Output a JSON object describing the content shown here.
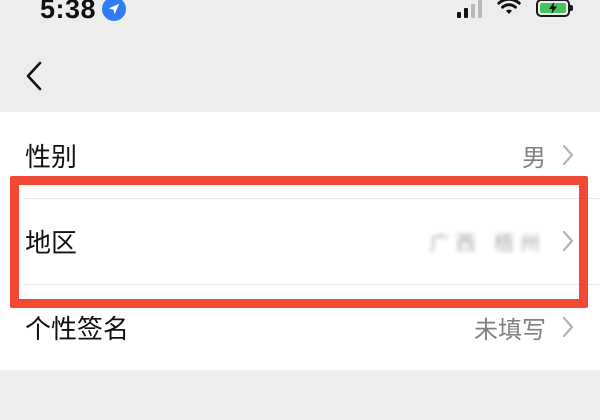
{
  "status_bar": {
    "time": "5:38"
  },
  "settings": {
    "rows": [
      {
        "label": "性别",
        "value": "男"
      },
      {
        "label": "地区",
        "value": "广西 梧州"
      },
      {
        "label": "个性签名",
        "value": "未填写"
      }
    ]
  },
  "colors": {
    "page_bg": "#ededed",
    "highlight": "#f04a35",
    "location_badge": "#2f7cf6",
    "battery": "#46c35a"
  },
  "icons": {
    "back": "chevron-left-icon",
    "row_chevron": "chevron-right-icon",
    "location": "location-arrow-icon",
    "signal": "cellular-signal-icon",
    "wifi": "wifi-icon",
    "battery": "battery-charging-icon"
  }
}
